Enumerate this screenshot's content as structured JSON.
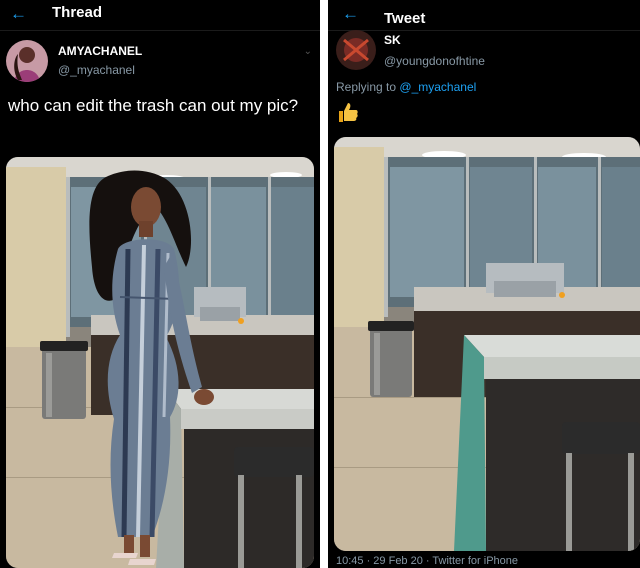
{
  "left": {
    "topbar": {
      "back_icon": "arrow-left-icon",
      "title": "Thread"
    },
    "author": {
      "name": "AMYACHANEL",
      "handle": "@_myachanel"
    },
    "tweet_text": "who can edit the trash can out my pic?",
    "colors": {
      "accent": "#1da1f2",
      "background": "#000000",
      "muted": "#8899a6"
    }
  },
  "right": {
    "topbar": {
      "back_icon": "arrow-left-icon",
      "title": "Tweet"
    },
    "author": {
      "name": "SK",
      "handle": "@youngdonofhtine"
    },
    "reply": {
      "prefix": "Replying to",
      "mention": "@_myachanel"
    },
    "reaction": "thumbs-up-icon",
    "footer": "10:45 · 29 Feb 20 · Twitter for iPhone"
  }
}
